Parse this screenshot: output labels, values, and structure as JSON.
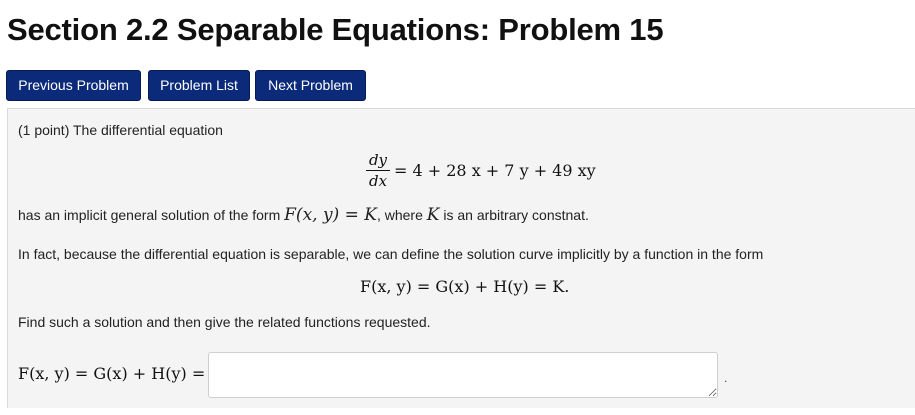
{
  "page": {
    "title": "Section 2.2 Separable Equations: Problem 15"
  },
  "nav": {
    "previous_label": "Previous Problem",
    "list_label": "Problem List",
    "next_label": "Next Problem"
  },
  "problem": {
    "intro": "(1 point) The differential equation",
    "lhs_num": "dy",
    "lhs_den": "dx",
    "rhs": "= 4 + 28 x + 7 y + 49 xy",
    "implicit_line_prefix": "has an implicit general solution of the form ",
    "implicit_line_form": "F(x, y) = K",
    "implicit_line_mid": ", where ",
    "implicit_line_k": "K",
    "implicit_line_suffix": " is an arbitrary constnat.",
    "separable_text": "In fact, because the differential equation is separable, we can define the solution curve implicitly by a function in the form",
    "center_equation": "F(x, y) = G(x) + H(y) = K.",
    "instruction": "Find such a solution and then give the related functions requested.",
    "answer_label": "F(x, y) = G(x) + H(y) =",
    "answer_value": "",
    "trailing_mark": "."
  },
  "colors": {
    "nav_button_bg": "#0b2a7a",
    "problem_bg": "#f4f4f4"
  }
}
